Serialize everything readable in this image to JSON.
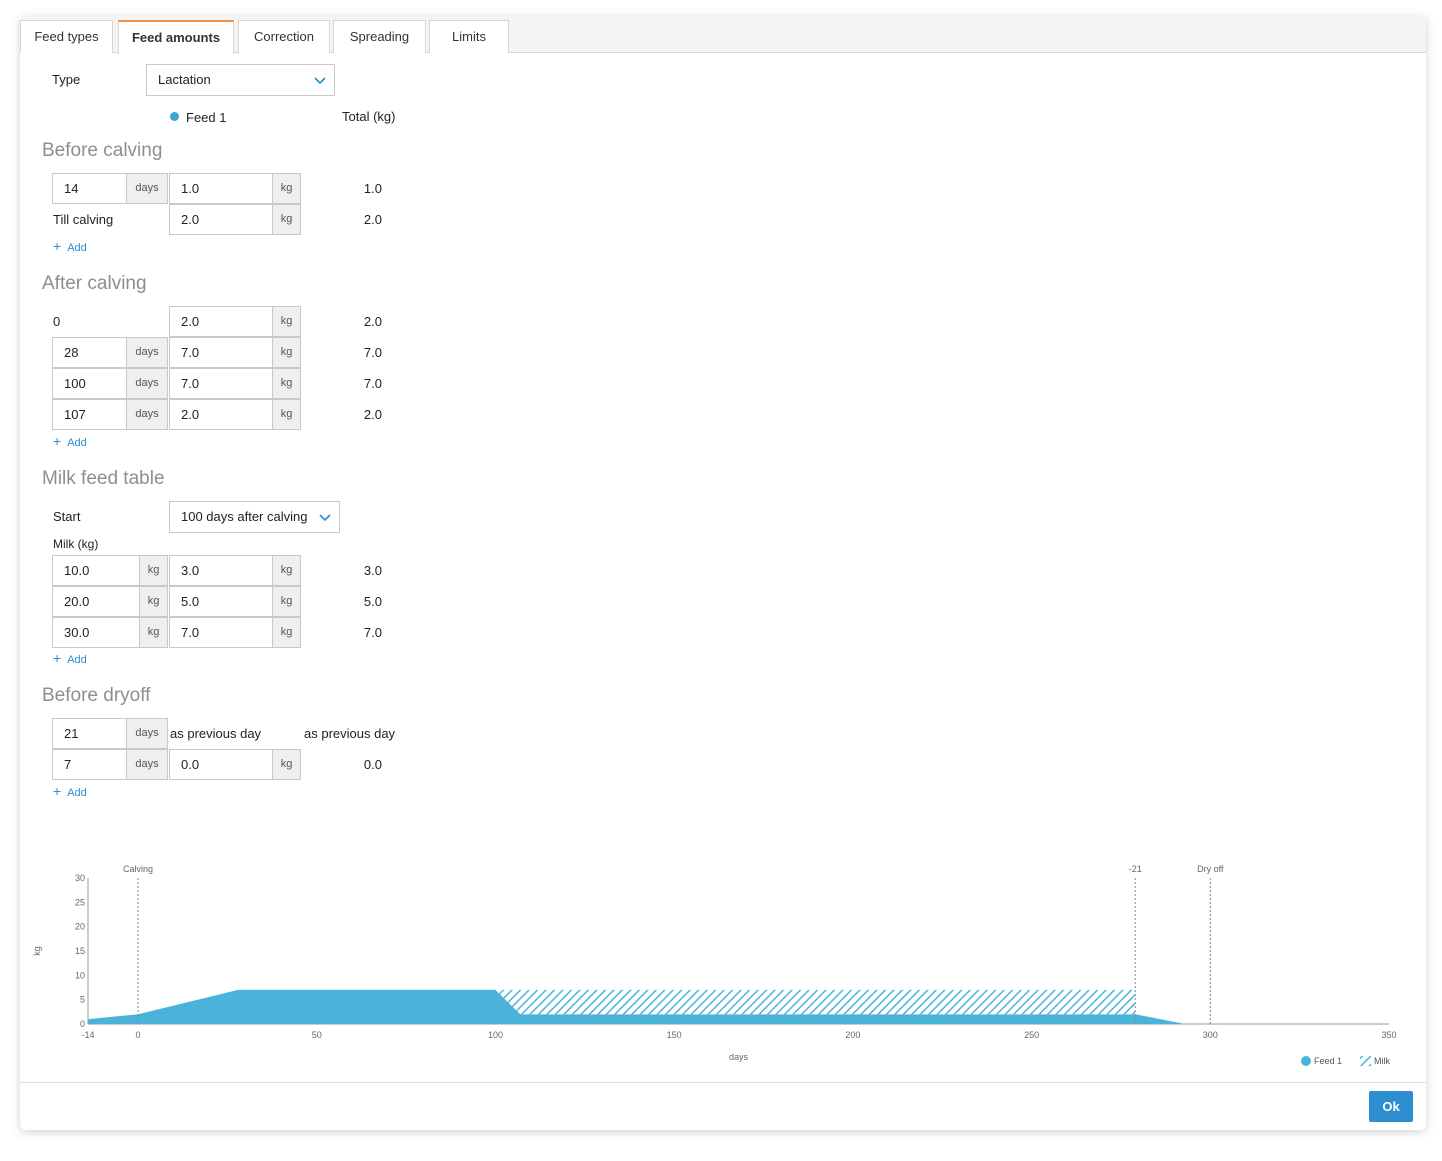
{
  "tabs": [
    {
      "label": "Feed types"
    },
    {
      "label": "Feed amounts"
    },
    {
      "label": "Correction"
    },
    {
      "label": "Spreading"
    },
    {
      "label": "Limits"
    }
  ],
  "type_label": "Type",
  "type_value": "Lactation",
  "feed_header": "Feed 1",
  "total_header": "Total (kg)",
  "add_label": "Add",
  "before_calving": {
    "title": "Before calving",
    "row1": {
      "days": "14",
      "days_unit": "days",
      "amount": "1.0",
      "unit": "kg",
      "total": "1.0"
    },
    "row2": {
      "label": "Till calving",
      "amount": "2.0",
      "unit": "kg",
      "total": "2.0"
    }
  },
  "after_calving": {
    "title": "After calving",
    "row0": {
      "label": "0",
      "amount": "2.0",
      "unit": "kg",
      "total": "2.0"
    },
    "rows": [
      {
        "days": "28",
        "days_unit": "days",
        "amount": "7.0",
        "unit": "kg",
        "total": "7.0"
      },
      {
        "days": "100",
        "days_unit": "days",
        "amount": "7.0",
        "unit": "kg",
        "total": "7.0"
      },
      {
        "days": "107",
        "days_unit": "days",
        "amount": "2.0",
        "unit": "kg",
        "total": "2.0"
      }
    ]
  },
  "milk_feed": {
    "title": "Milk feed table",
    "start_label": "Start",
    "start_value": "100 days after calving",
    "milk_label": "Milk (kg)",
    "rows": [
      {
        "milk": "10.0",
        "milk_unit": "kg",
        "amount": "3.0",
        "unit": "kg",
        "total": "3.0"
      },
      {
        "milk": "20.0",
        "milk_unit": "kg",
        "amount": "5.0",
        "unit": "kg",
        "total": "5.0"
      },
      {
        "milk": "30.0",
        "milk_unit": "kg",
        "amount": "7.0",
        "unit": "kg",
        "total": "7.0"
      }
    ]
  },
  "before_dryoff": {
    "title": "Before dryoff",
    "row1": {
      "days": "21",
      "days_unit": "days",
      "amount": "as previous day",
      "total": "as previous day"
    },
    "row2": {
      "days": "7",
      "days_unit": "days",
      "amount": "0.0",
      "unit": "kg",
      "total": "0.0"
    }
  },
  "ok_label": "Ok",
  "colors": {
    "accent": "#2d8fd0",
    "feed": "#4bb3da",
    "tab_active": "#f0903c"
  },
  "chart_data": {
    "type": "area",
    "xlabel": "days",
    "ylabel": "kg",
    "xlim": [
      -14,
      350
    ],
    "ylim": [
      0,
      30
    ],
    "x_ticks": [
      "-14",
      "0",
      "50",
      "100",
      "150",
      "200",
      "250",
      "300",
      "350"
    ],
    "y_ticks": [
      "0",
      "5",
      "10",
      "15",
      "20",
      "25",
      "30"
    ],
    "markers": [
      {
        "label": "Calving",
        "x": 0
      },
      {
        "label": "-21",
        "x": 279
      },
      {
        "label": "Dry off",
        "x": 300
      }
    ],
    "series": [
      {
        "name": "Feed 1",
        "style": "solid",
        "x": [
          -14,
          0,
          28,
          100,
          107,
          279,
          293
        ],
        "y": [
          1,
          2,
          7,
          7,
          2,
          2,
          0
        ]
      },
      {
        "name": "Milk",
        "style": "hatched",
        "x": [
          100,
          107,
          279
        ],
        "y": [
          0,
          5,
          5
        ]
      }
    ],
    "legend": [
      {
        "label": "Feed 1"
      },
      {
        "label": "Milk"
      }
    ],
    "legend_position": "bottom-right"
  }
}
